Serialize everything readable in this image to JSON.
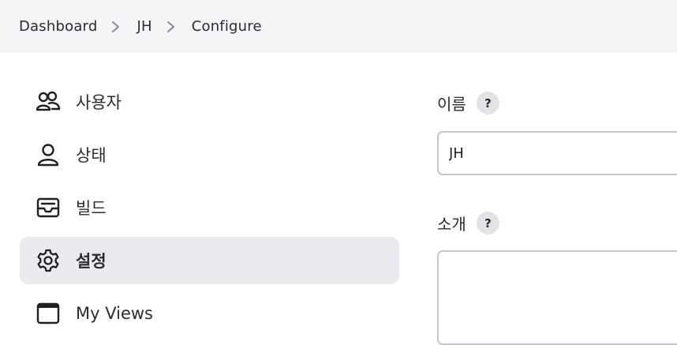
{
  "breadcrumb": {
    "items": [
      "Dashboard",
      "JH",
      "Configure"
    ]
  },
  "sidebar": {
    "items": [
      {
        "label": "사용자",
        "icon": "people-icon",
        "active": false
      },
      {
        "label": "상태",
        "icon": "person-icon",
        "active": false
      },
      {
        "label": "빌드",
        "icon": "inbox-icon",
        "active": false
      },
      {
        "label": "설정",
        "icon": "gear-icon",
        "active": true
      },
      {
        "label": "My Views",
        "icon": "window-icon",
        "active": false
      }
    ]
  },
  "form": {
    "name_label": "이름",
    "name_value": "JH",
    "description_label": "소개",
    "description_value": "",
    "help_glyph": "?"
  },
  "colors": {
    "breadcrumb_bg": "#f5f5f7",
    "active_item_bg": "#ebebef",
    "input_border": "#c3c6cc",
    "help_bg": "#e3e3e7"
  }
}
